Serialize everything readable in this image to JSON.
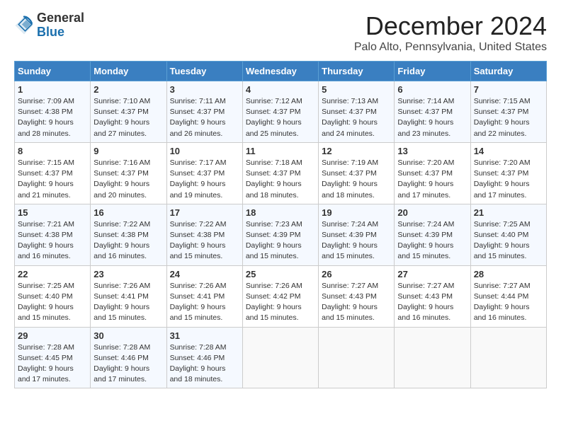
{
  "header": {
    "logo_line1": "General",
    "logo_line2": "Blue",
    "month_title": "December 2024",
    "location": "Palo Alto, Pennsylvania, United States"
  },
  "days_of_week": [
    "Sunday",
    "Monday",
    "Tuesday",
    "Wednesday",
    "Thursday",
    "Friday",
    "Saturday"
  ],
  "weeks": [
    [
      {
        "day": "1",
        "sunrise": "7:09 AM",
        "sunset": "4:38 PM",
        "daylight": "9 hours and 28 minutes."
      },
      {
        "day": "2",
        "sunrise": "7:10 AM",
        "sunset": "4:37 PM",
        "daylight": "9 hours and 27 minutes."
      },
      {
        "day": "3",
        "sunrise": "7:11 AM",
        "sunset": "4:37 PM",
        "daylight": "9 hours and 26 minutes."
      },
      {
        "day": "4",
        "sunrise": "7:12 AM",
        "sunset": "4:37 PM",
        "daylight": "9 hours and 25 minutes."
      },
      {
        "day": "5",
        "sunrise": "7:13 AM",
        "sunset": "4:37 PM",
        "daylight": "9 hours and 24 minutes."
      },
      {
        "day": "6",
        "sunrise": "7:14 AM",
        "sunset": "4:37 PM",
        "daylight": "9 hours and 23 minutes."
      },
      {
        "day": "7",
        "sunrise": "7:15 AM",
        "sunset": "4:37 PM",
        "daylight": "9 hours and 22 minutes."
      }
    ],
    [
      {
        "day": "8",
        "sunrise": "7:15 AM",
        "sunset": "4:37 PM",
        "daylight": "9 hours and 21 minutes."
      },
      {
        "day": "9",
        "sunrise": "7:16 AM",
        "sunset": "4:37 PM",
        "daylight": "9 hours and 20 minutes."
      },
      {
        "day": "10",
        "sunrise": "7:17 AM",
        "sunset": "4:37 PM",
        "daylight": "9 hours and 19 minutes."
      },
      {
        "day": "11",
        "sunrise": "7:18 AM",
        "sunset": "4:37 PM",
        "daylight": "9 hours and 18 minutes."
      },
      {
        "day": "12",
        "sunrise": "7:19 AM",
        "sunset": "4:37 PM",
        "daylight": "9 hours and 18 minutes."
      },
      {
        "day": "13",
        "sunrise": "7:20 AM",
        "sunset": "4:37 PM",
        "daylight": "9 hours and 17 minutes."
      },
      {
        "day": "14",
        "sunrise": "7:20 AM",
        "sunset": "4:37 PM",
        "daylight": "9 hours and 17 minutes."
      }
    ],
    [
      {
        "day": "15",
        "sunrise": "7:21 AM",
        "sunset": "4:38 PM",
        "daylight": "9 hours and 16 minutes."
      },
      {
        "day": "16",
        "sunrise": "7:22 AM",
        "sunset": "4:38 PM",
        "daylight": "9 hours and 16 minutes."
      },
      {
        "day": "17",
        "sunrise": "7:22 AM",
        "sunset": "4:38 PM",
        "daylight": "9 hours and 15 minutes."
      },
      {
        "day": "18",
        "sunrise": "7:23 AM",
        "sunset": "4:39 PM",
        "daylight": "9 hours and 15 minutes."
      },
      {
        "day": "19",
        "sunrise": "7:24 AM",
        "sunset": "4:39 PM",
        "daylight": "9 hours and 15 minutes."
      },
      {
        "day": "20",
        "sunrise": "7:24 AM",
        "sunset": "4:39 PM",
        "daylight": "9 hours and 15 minutes."
      },
      {
        "day": "21",
        "sunrise": "7:25 AM",
        "sunset": "4:40 PM",
        "daylight": "9 hours and 15 minutes."
      }
    ],
    [
      {
        "day": "22",
        "sunrise": "7:25 AM",
        "sunset": "4:40 PM",
        "daylight": "9 hours and 15 minutes."
      },
      {
        "day": "23",
        "sunrise": "7:26 AM",
        "sunset": "4:41 PM",
        "daylight": "9 hours and 15 minutes."
      },
      {
        "day": "24",
        "sunrise": "7:26 AM",
        "sunset": "4:41 PM",
        "daylight": "9 hours and 15 minutes."
      },
      {
        "day": "25",
        "sunrise": "7:26 AM",
        "sunset": "4:42 PM",
        "daylight": "9 hours and 15 minutes."
      },
      {
        "day": "26",
        "sunrise": "7:27 AM",
        "sunset": "4:43 PM",
        "daylight": "9 hours and 15 minutes."
      },
      {
        "day": "27",
        "sunrise": "7:27 AM",
        "sunset": "4:43 PM",
        "daylight": "9 hours and 16 minutes."
      },
      {
        "day": "28",
        "sunrise": "7:27 AM",
        "sunset": "4:44 PM",
        "daylight": "9 hours and 16 minutes."
      }
    ],
    [
      {
        "day": "29",
        "sunrise": "7:28 AM",
        "sunset": "4:45 PM",
        "daylight": "9 hours and 17 minutes."
      },
      {
        "day": "30",
        "sunrise": "7:28 AM",
        "sunset": "4:46 PM",
        "daylight": "9 hours and 17 minutes."
      },
      {
        "day": "31",
        "sunrise": "7:28 AM",
        "sunset": "4:46 PM",
        "daylight": "9 hours and 18 minutes."
      },
      null,
      null,
      null,
      null
    ]
  ],
  "labels": {
    "sunrise": "Sunrise:",
    "sunset": "Sunset:",
    "daylight": "Daylight:"
  }
}
